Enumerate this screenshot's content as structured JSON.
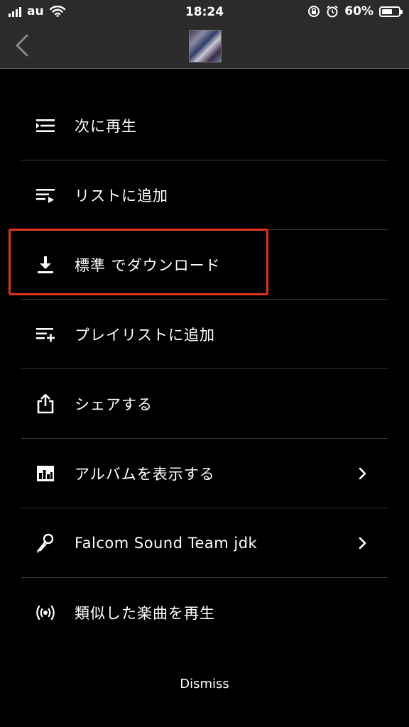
{
  "status_bar": {
    "carrier": "au",
    "time": "18:24",
    "battery_percent": "60%"
  },
  "nav": {
    "back_icon": "chevron-left-icon",
    "album_art": "album-thumbnail"
  },
  "menu": {
    "items": [
      {
        "label": "次に再生",
        "icon": "play-next-icon",
        "has_chevron": false
      },
      {
        "label": "リストに追加",
        "icon": "add-to-queue-icon",
        "has_chevron": false
      },
      {
        "label": "標準 でダウンロード",
        "icon": "download-icon",
        "has_chevron": false
      },
      {
        "label": "プレイリストに追加",
        "icon": "add-to-playlist-icon",
        "has_chevron": false
      },
      {
        "label": "シェアする",
        "icon": "share-icon",
        "has_chevron": false
      },
      {
        "label": "アルバムを表示する",
        "icon": "album-icon",
        "has_chevron": true
      },
      {
        "label": "Falcom Sound Team jdk",
        "icon": "microphone-icon",
        "has_chevron": true
      },
      {
        "label": "類似した楽曲を再生",
        "icon": "radio-icon",
        "has_chevron": false
      }
    ]
  },
  "dismiss_label": "Dismiss",
  "colors": {
    "highlight": "#e23418",
    "background": "#000000",
    "bar": "#2b2b2b"
  }
}
